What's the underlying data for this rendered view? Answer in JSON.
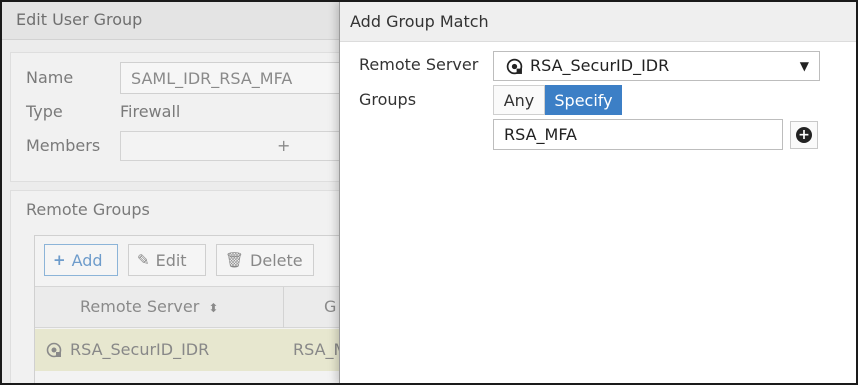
{
  "background": {
    "title": "Edit User Group",
    "form": {
      "name_label": "Name",
      "name_value": "SAML_IDR_RSA_MFA",
      "type_label": "Type",
      "type_value": "Firewall",
      "members_label": "Members",
      "members_add": "+"
    },
    "remote_groups": {
      "title": "Remote Groups",
      "buttons": {
        "add": "Add",
        "edit": "Edit",
        "delete": "Delete"
      },
      "columns": [
        "Remote Server",
        "G"
      ],
      "rows": [
        {
          "server": "RSA_SecurID_IDR",
          "group": "RSA_M"
        }
      ]
    }
  },
  "dialog": {
    "title": "Add Group Match",
    "remote_server_label": "Remote Server",
    "remote_server_value": "RSA_SecurID_IDR",
    "groups_label": "Groups",
    "groups_toggle": {
      "any": "Any",
      "specify": "Specify",
      "selected": "Specify"
    },
    "group_value": "RSA_MFA"
  },
  "colors": {
    "accent": "#3c7fc6",
    "selected_row": "#e7e7cf"
  }
}
